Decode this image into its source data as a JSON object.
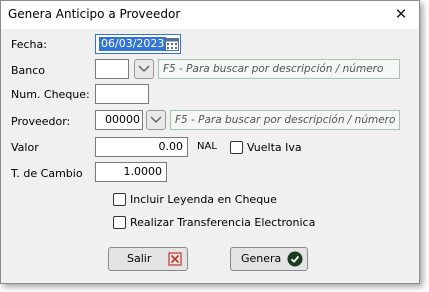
{
  "window": {
    "title": "Genera Anticipo a Proveedor",
    "close_glyph": "✕"
  },
  "form": {
    "fecha": {
      "label": "Fecha:",
      "value": "06/03/2023"
    },
    "banco": {
      "label": "Banco",
      "value": "",
      "hint": "F5 - Para buscar por descripción / número"
    },
    "num_cheque": {
      "label": "Num. Cheque:",
      "value": ""
    },
    "proveedor": {
      "label": "Proveedor:",
      "value": "00000",
      "hint": "F5 - Para buscar por descripción / número"
    },
    "valor": {
      "label": "Valor",
      "value": "0.00",
      "unit": "NAL"
    },
    "vuelta_iva": {
      "label": "Vuelta Iva",
      "checked": false
    },
    "tipo_cambio": {
      "label": "T. de Cambio",
      "value": "1.0000"
    },
    "incluir_leyenda": {
      "label": "Incluir Leyenda en Cheque",
      "checked": false
    },
    "realizar_transferencia": {
      "label": "Realizar Transferencia Electronica",
      "checked": false
    }
  },
  "buttons": {
    "salir": {
      "label": "Salir",
      "icon": "close-x-icon",
      "color": "#c0392b"
    },
    "genera": {
      "label": "Genera",
      "icon": "check-circle-icon",
      "color": "#1e3a1e"
    }
  },
  "colors": {
    "accent_selection": "#3375d6",
    "hint_border": "#a7c4b5"
  }
}
